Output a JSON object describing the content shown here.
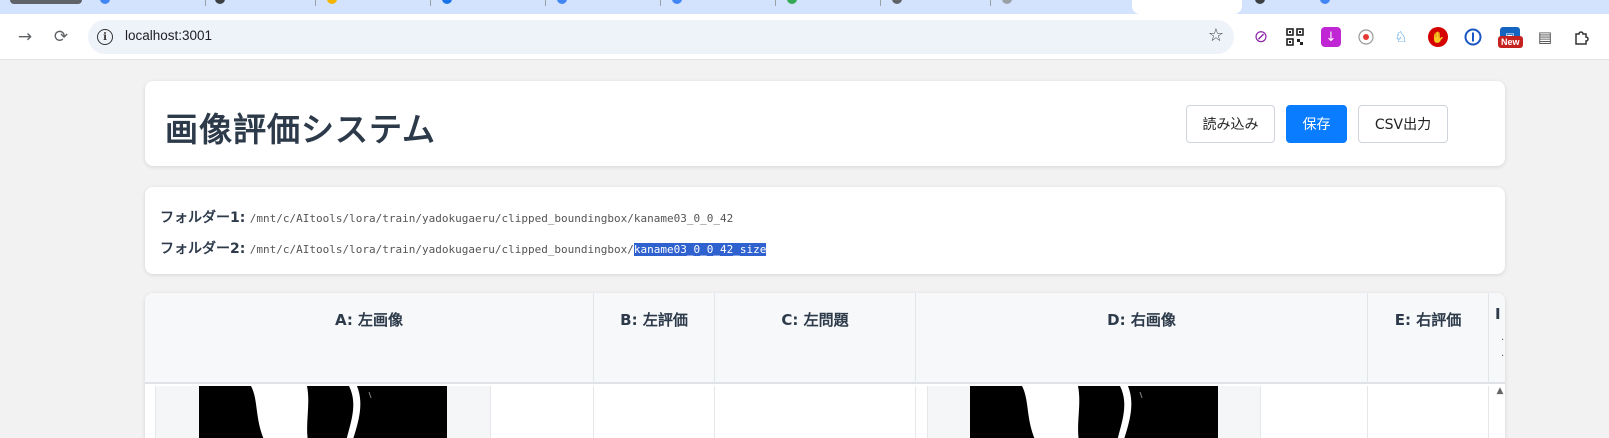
{
  "browser": {
    "url": "localhost:3001",
    "extension_badge": "New",
    "icons": [
      "back-arrow-icon",
      "reload-icon",
      "info-icon",
      "star-icon",
      "extension-puzzle-icon"
    ]
  },
  "header": {
    "title": "画像評価システム",
    "buttons": {
      "load": "読み込み",
      "save": "保存",
      "csv": "CSV出力"
    },
    "accent_color": "#0a7cff"
  },
  "folders": {
    "folder1_label": "フォルダー1:",
    "folder1_path": "/mnt/c/AItools/lora/train/yadokugaeru/clipped_boundingbox/kaname03_0_0_42",
    "folder2_label": "フォルダー2:",
    "folder2_path_prefix": "/mnt/c/AItools/lora/train/yadokugaeru/clipped_boundingbox/",
    "folder2_path_selected": "kaname03_0_0_42_size"
  },
  "table": {
    "columns": [
      "A: 左画像",
      "B: 左評価",
      "C: 左問題",
      "D: 右画像",
      "E: 右評価"
    ],
    "last_column_partial": "I"
  }
}
